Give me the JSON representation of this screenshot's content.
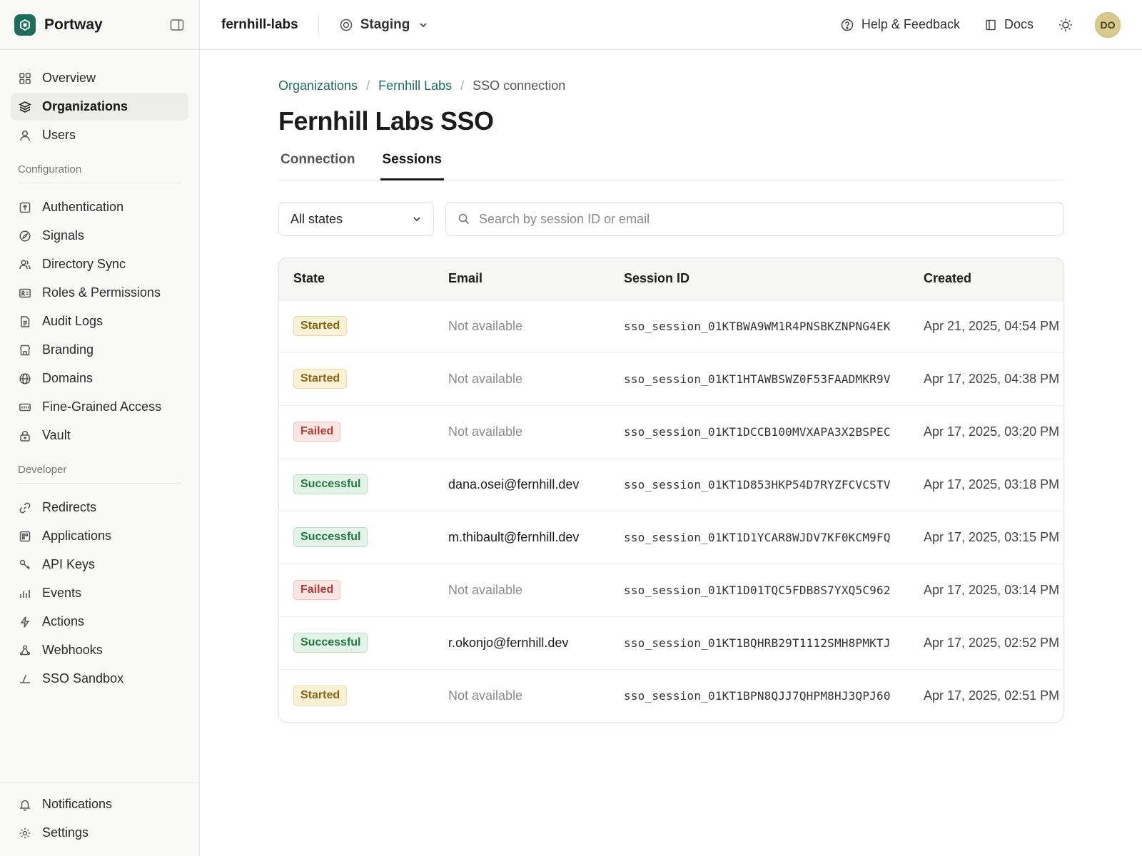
{
  "brand": {
    "name": "Portway"
  },
  "sidebar": {
    "main_items": [
      {
        "label": "Overview",
        "icon": "grid-icon",
        "active": false
      },
      {
        "label": "Organizations",
        "icon": "layers-icon",
        "active": true
      },
      {
        "label": "Users",
        "icon": "user-icon",
        "active": false
      }
    ],
    "config_heading": "Configuration",
    "config_items": [
      {
        "label": "Authentication",
        "icon": "upload-box-icon"
      },
      {
        "label": "Signals",
        "icon": "compass-icon"
      },
      {
        "label": "Directory Sync",
        "icon": "users-icon"
      },
      {
        "label": "Roles & Permissions",
        "icon": "id-card-icon"
      },
      {
        "label": "Audit Logs",
        "icon": "file-icon"
      },
      {
        "label": "Branding",
        "icon": "storefront-icon"
      },
      {
        "label": "Domains",
        "icon": "globe-icon"
      },
      {
        "label": "Fine-Grained Access",
        "icon": "keypad-icon"
      },
      {
        "label": "Vault",
        "icon": "lock-icon"
      }
    ],
    "developer_heading": "Developer",
    "developer_items": [
      {
        "label": "Redirects",
        "icon": "link-icon"
      },
      {
        "label": "Applications",
        "icon": "app-icon"
      },
      {
        "label": "API Keys",
        "icon": "key-icon"
      },
      {
        "label": "Events",
        "icon": "bar-chart-icon"
      },
      {
        "label": "Actions",
        "icon": "bolt-icon"
      },
      {
        "label": "Webhooks",
        "icon": "webhook-icon"
      },
      {
        "label": "SSO Sandbox",
        "icon": "sandbox-icon"
      }
    ],
    "footer_items": [
      {
        "label": "Notifications",
        "icon": "bell-icon"
      },
      {
        "label": "Settings",
        "icon": "gear-icon"
      }
    ]
  },
  "topbar": {
    "org": "fernhill-labs",
    "environment": "Staging",
    "help_label": "Help & Feedback",
    "docs_label": "Docs",
    "avatar_initials": "DO"
  },
  "breadcrumb": {
    "items": [
      "Organizations",
      "Fernhill Labs"
    ],
    "current": "SSO connection"
  },
  "page": {
    "title": "Fernhill Labs SSO",
    "tabs": [
      {
        "label": "Connection",
        "active": false
      },
      {
        "label": "Sessions",
        "active": true
      }
    ]
  },
  "filters": {
    "state_select": "All states",
    "search_placeholder": "Search by session ID or email"
  },
  "table": {
    "headers": [
      "State",
      "Email",
      "Session ID",
      "Created"
    ],
    "rows": [
      {
        "state": "Started",
        "email": "Not available",
        "session_id": "sso_session_01KTBWA9WM1R4PNSBKZNPNG4EK",
        "created": "Apr 21, 2025, 04:54 PM"
      },
      {
        "state": "Started",
        "email": "Not available",
        "session_id": "sso_session_01KT1HTAWBSWZ0F53FAADMKR9V",
        "created": "Apr 17, 2025, 04:38 PM"
      },
      {
        "state": "Failed",
        "email": "Not available",
        "session_id": "sso_session_01KT1DCCB100MVXAPA3X2BSPEC",
        "created": "Apr 17, 2025, 03:20 PM"
      },
      {
        "state": "Successful",
        "email": "dana.osei@fernhill.dev",
        "session_id": "sso_session_01KT1D853HKP54D7RYZFCVCSTV",
        "created": "Apr 17, 2025, 03:18 PM"
      },
      {
        "state": "Successful",
        "email": "m.thibault@fernhill.dev",
        "session_id": "sso_session_01KT1D1YCAR8WJDV7KF0KCM9FQ",
        "created": "Apr 17, 2025, 03:15 PM"
      },
      {
        "state": "Failed",
        "email": "Not available",
        "session_id": "sso_session_01KT1D01TQC5FDB8S7YXQ5C962",
        "created": "Apr 17, 2025, 03:14 PM"
      },
      {
        "state": "Successful",
        "email": "r.okonjo@fernhill.dev",
        "session_id": "sso_session_01KT1BQHRB29T1112SMH8PMKTJ",
        "created": "Apr 17, 2025, 02:52 PM"
      },
      {
        "state": "Started",
        "email": "Not available",
        "session_id": "sso_session_01KT1BPN8QJJ7QHPM8HJ3QPJ60",
        "created": "Apr 17, 2025, 02:51 PM"
      }
    ]
  },
  "colors": {
    "brand": "#1f6b5c",
    "link": "#236a5d",
    "started_bg": "#fbf1d6",
    "failed_bg": "#fbe5e3",
    "successful_bg": "#e4f3e8"
  }
}
